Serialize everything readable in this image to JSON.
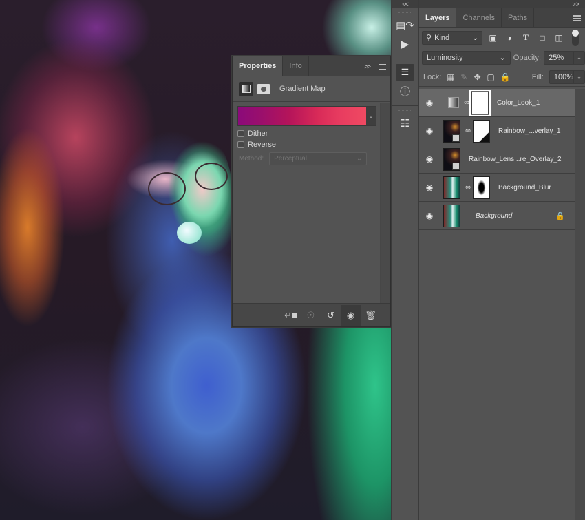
{
  "canvas": {
    "description": "Photo of person with glasses blowing bubble gum, rainbow lens flare overlay"
  },
  "properties_panel": {
    "tabs": [
      {
        "label": "Properties",
        "active": true
      },
      {
        "label": "Info",
        "active": false
      }
    ],
    "expand_icon": ">>",
    "adjustment_type": "Gradient Map",
    "gradient": {
      "colors": [
        "#8b0a7a",
        "#b5145a",
        "#d82a58",
        "#ef4a62"
      ]
    },
    "dither": {
      "label": "Dither",
      "checked": false
    },
    "reverse": {
      "label": "Reverse",
      "checked": false
    },
    "method": {
      "label": "Method:",
      "value": "Perceptual",
      "disabled": true
    },
    "footer_buttons": [
      "clip-to-layer",
      "view-previous-state",
      "reset-to-defaults",
      "toggle-visibility",
      "delete-adjustment"
    ]
  },
  "dock": {
    "collapse": "<<",
    "buttons": [
      "history",
      "actions",
      "adjustments",
      "info",
      "tool-presets"
    ]
  },
  "layers_panel": {
    "collapse": ">>",
    "tabs": [
      {
        "label": "Layers",
        "active": true
      },
      {
        "label": "Channels",
        "active": false
      },
      {
        "label": "Paths",
        "active": false
      }
    ],
    "filter_kind": "Kind",
    "blend_mode": "Luminosity",
    "opacity_label": "Opacity:",
    "opacity": "25%",
    "lock_label": "Lock:",
    "fill_label": "Fill:",
    "fill": "100%",
    "layers": [
      {
        "name": "Color_Look_1",
        "visible": true,
        "selected": true,
        "type": "adjustment",
        "has_mask": true,
        "italic": false,
        "locked": false
      },
      {
        "name": "Rainbow_...verlay_1",
        "visible": true,
        "selected": false,
        "type": "smart-object",
        "has_mask": true,
        "italic": false,
        "locked": false
      },
      {
        "name": "Rainbow_Lens...re_Overlay_2",
        "visible": true,
        "selected": false,
        "type": "smart-object",
        "has_mask": false,
        "italic": false,
        "locked": false
      },
      {
        "name": "Background_Blur",
        "visible": true,
        "selected": false,
        "type": "pixel",
        "has_mask": true,
        "italic": false,
        "locked": false
      },
      {
        "name": "Background",
        "visible": true,
        "selected": false,
        "type": "pixel",
        "has_mask": false,
        "italic": true,
        "locked": true
      }
    ]
  }
}
